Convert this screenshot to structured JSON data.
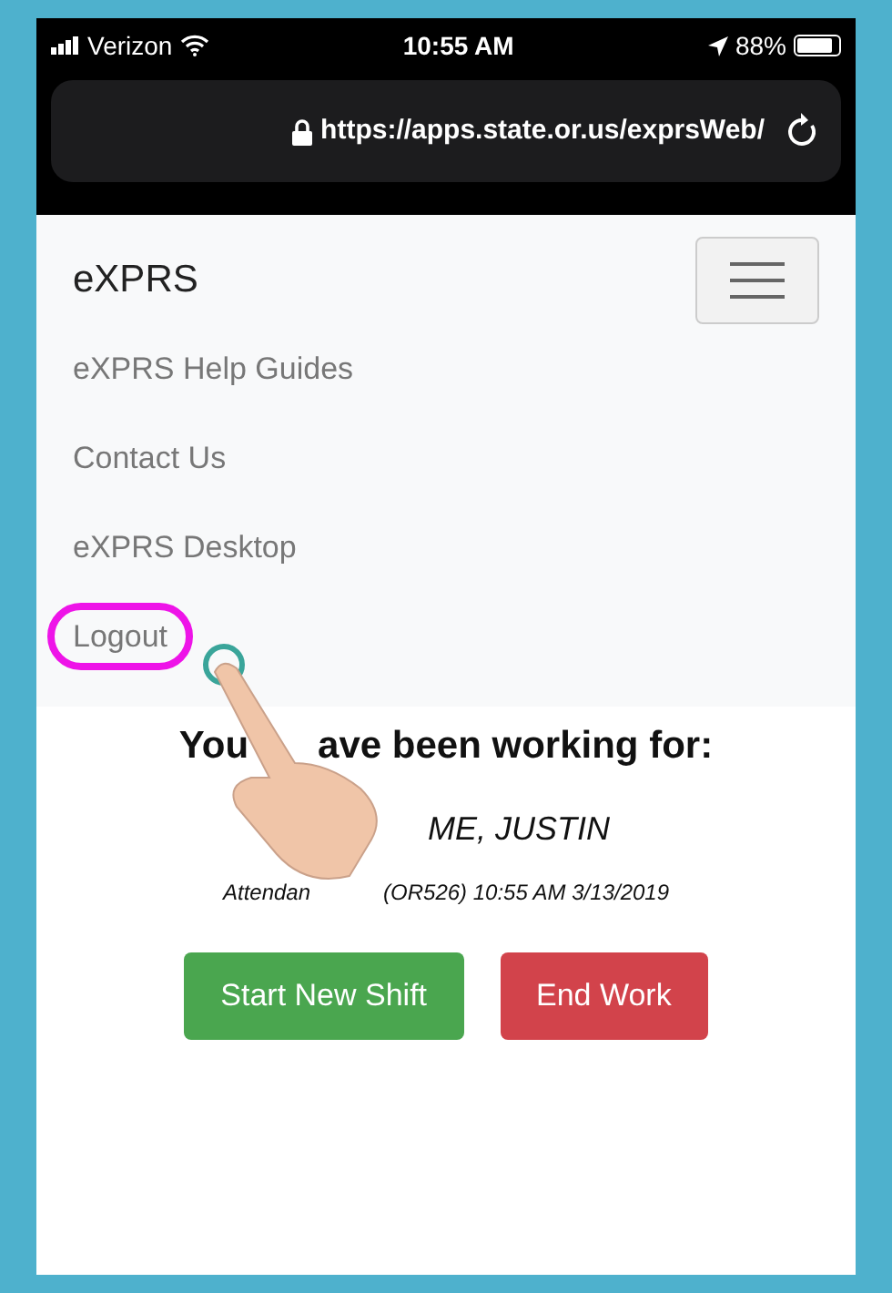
{
  "status_bar": {
    "carrier": "Verizon",
    "time": "10:55 AM",
    "battery": "88%"
  },
  "address_bar": {
    "url": "https://apps.state.or.us/exprsWeb/"
  },
  "navbar": {
    "brand": "eXPRS",
    "menu_expanded": true,
    "items": [
      {
        "label": "eXPRS Help Guides",
        "highlighted": false
      },
      {
        "label": "Contact Us",
        "highlighted": false
      },
      {
        "label": "eXPRS Desktop",
        "highlighted": false
      },
      {
        "label": "Logout",
        "highlighted": true
      }
    ]
  },
  "working_for": {
    "title_parts": [
      "You",
      "ave been working for:"
    ],
    "name": "ME, JUSTIN",
    "detail_parts": [
      "Attendan",
      "(OR526) 10:55 AM 3/13/2019"
    ]
  },
  "buttons": [
    {
      "label": "Start New Shift",
      "kind": "success"
    },
    {
      "label": "End Work",
      "kind": "danger"
    }
  ]
}
